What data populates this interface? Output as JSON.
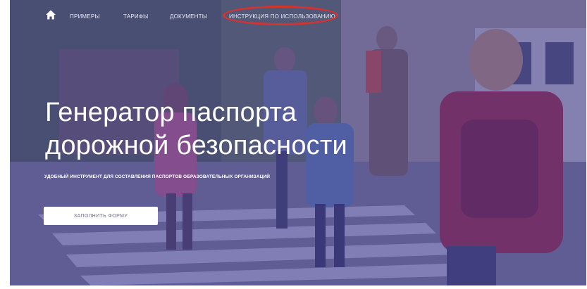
{
  "nav": {
    "home_icon": "home-icon",
    "links": [
      "ПРИМЕРЫ",
      "ТАРИФЫ",
      "ДОКУМЕНТЫ",
      "ИНСТРУКЦИЯ ПО ИСПОЛЬЗОВАНИЮ"
    ],
    "highlight_color": "#d6322e"
  },
  "hero": {
    "title_line1": "Генератор паспорта",
    "title_line2": "дорожной безопасности",
    "subtitle": "УДОБНЫЙ ИНСТРУМЕНТ ДЛЯ СОСТАВЛЕНИЯ ПАСПОРТОВ ОБРАЗОВАТЕЛЬНЫХ ОРГАНИЗАЦИЙ",
    "cta_label": "ЗАПОЛНИТЬ ФОРМУ",
    "overlay_color": "#3b3896"
  }
}
